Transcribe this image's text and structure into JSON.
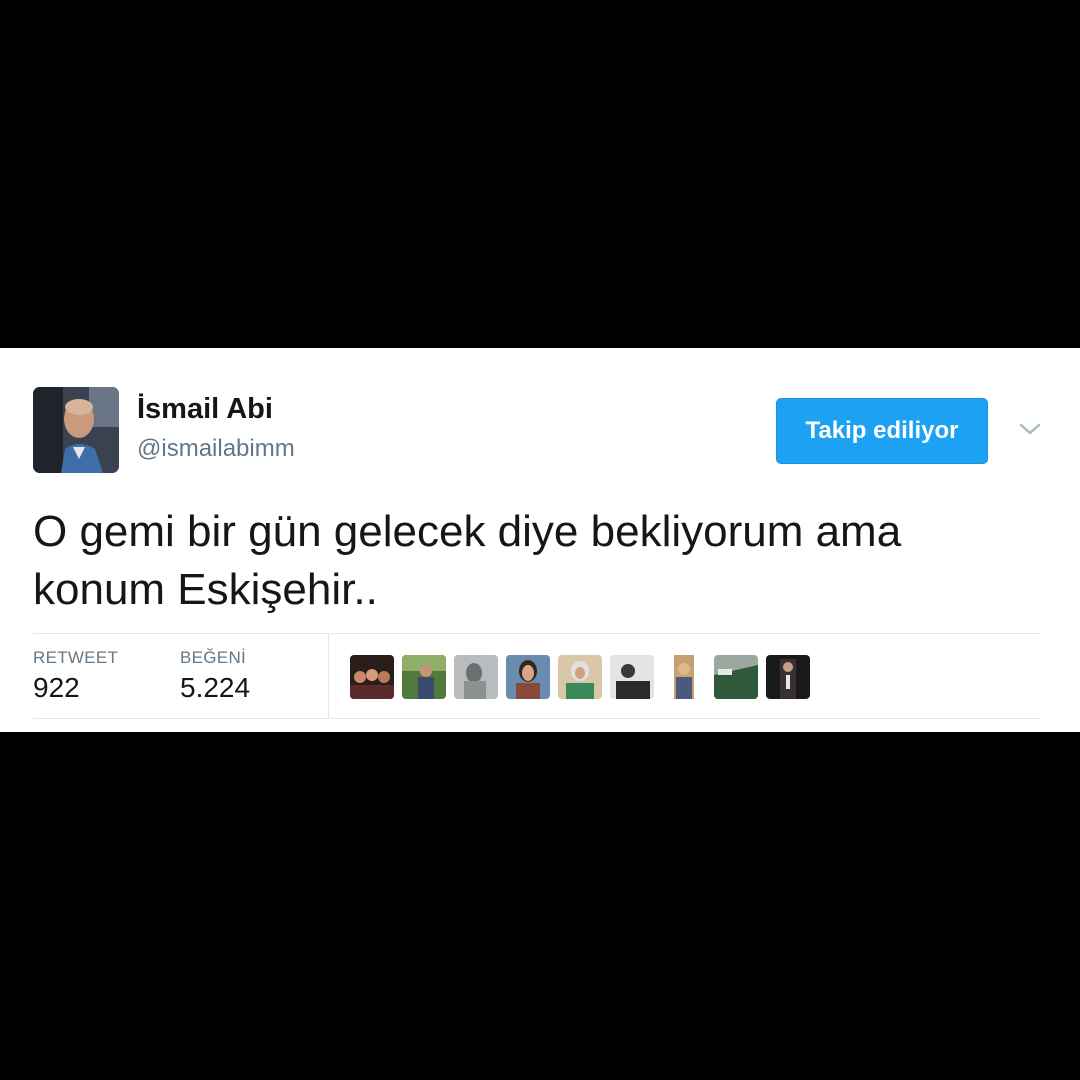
{
  "tweet": {
    "author": {
      "display_name": "İsmail Abi",
      "handle": "@ismailabimm",
      "avatar_icon": "profile-photo"
    },
    "follow_button_label": "Takip ediliyor",
    "menu_icon": "chevron-down-icon",
    "text": "O gemi bir gün gelecek diye bekliyorum ama konum Eskişehir..",
    "stats": {
      "retweet_label": "RETWEET",
      "retweet_count": "922",
      "like_label": "BEĞENİ",
      "like_count": "5.224"
    },
    "likers_count_shown": 9
  },
  "colors": {
    "accent": "#1da1f2",
    "text_primary": "#14171a",
    "text_secondary": "#657786",
    "border": "#e1e8ed",
    "background": "#000000"
  }
}
